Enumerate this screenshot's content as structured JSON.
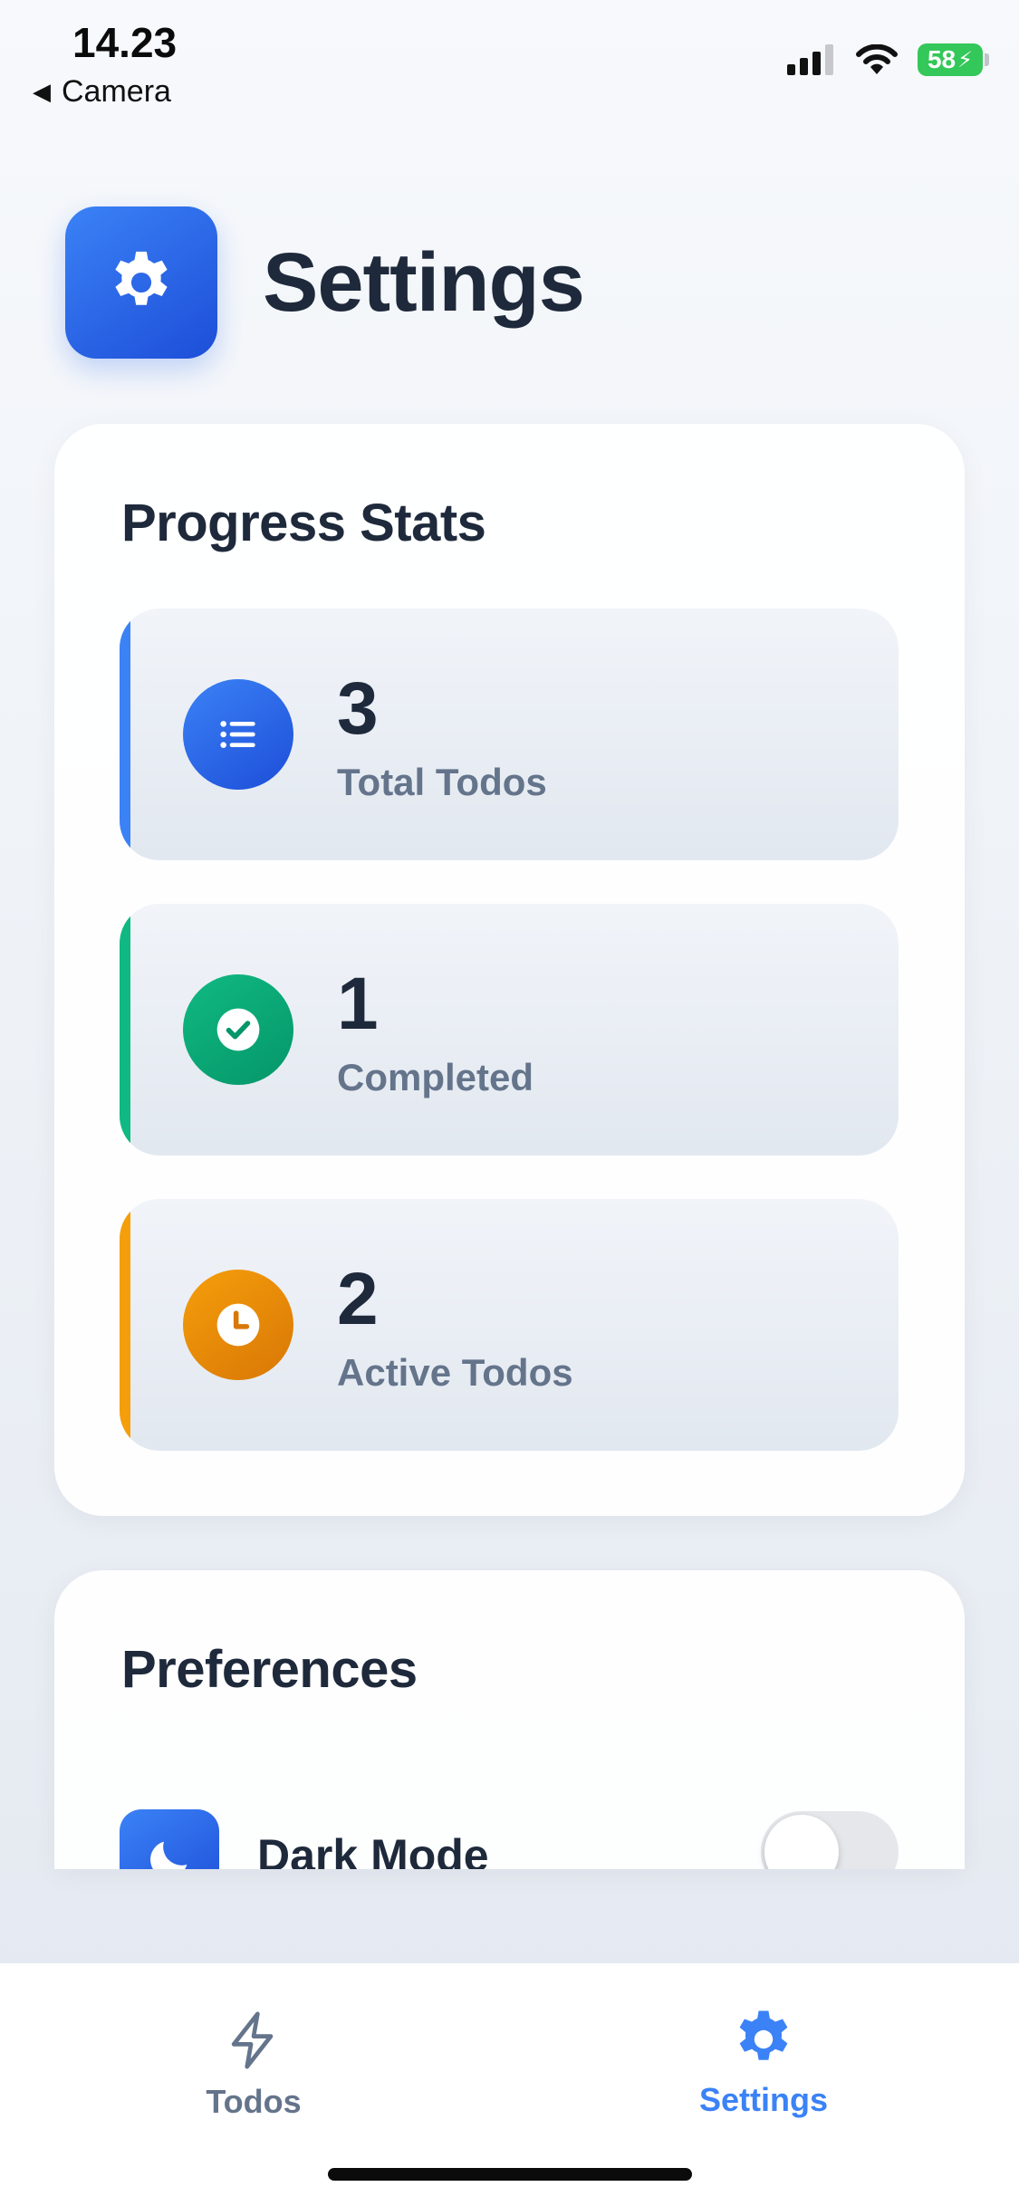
{
  "status_bar": {
    "time": "14.23",
    "back_label": "Camera",
    "battery_level": "58"
  },
  "header": {
    "title": "Settings",
    "icon": "gear-icon"
  },
  "progress_stats": {
    "title": "Progress Stats",
    "stats": [
      {
        "value": "3",
        "label": "Total Todos",
        "icon": "list-icon",
        "accent": "#3b82f6"
      },
      {
        "value": "1",
        "label": "Completed",
        "icon": "check-circle-icon",
        "accent": "#10b981"
      },
      {
        "value": "2",
        "label": "Active Todos",
        "icon": "clock-icon",
        "accent": "#f59e0b"
      }
    ]
  },
  "preferences": {
    "title": "Preferences",
    "items": [
      {
        "label": "Dark Mode",
        "icon": "moon-icon",
        "enabled": false
      }
    ]
  },
  "tab_bar": {
    "tabs": [
      {
        "label": "Todos",
        "icon": "lightning-icon",
        "active": false
      },
      {
        "label": "Settings",
        "icon": "gear-icon",
        "active": true
      }
    ]
  },
  "colors": {
    "accent_blue": "#3b82f6",
    "accent_green": "#10b981",
    "accent_orange": "#f59e0b",
    "text_primary": "#1e293b",
    "text_secondary": "#64748b"
  }
}
